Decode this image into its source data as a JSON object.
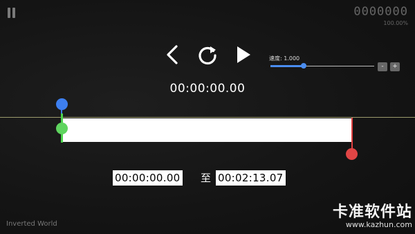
{
  "header": {
    "score": "0000000",
    "progress_percent": "100.00%"
  },
  "controls": {
    "back_icon": "chevron-left",
    "replay_icon": "replay",
    "play_icon": "play"
  },
  "current_time": "00:00:00.00",
  "speed": {
    "label": "速度: 1.000",
    "value": 1.0,
    "slider_fraction": 0.32,
    "minus_label": "-",
    "plus_label": "+"
  },
  "range": {
    "start": "00:00:00.00",
    "to_label": "至",
    "end": "00:02:13.07"
  },
  "track_name": "Inverted World",
  "watermark": {
    "text": "卡准软件站",
    "url": "www.kazhun.com"
  },
  "colors": {
    "blue_marker": "#3d7ff0",
    "green_marker": "#5fd45f",
    "red_marker": "#e04545",
    "slider_accent": "#4a8df0"
  }
}
